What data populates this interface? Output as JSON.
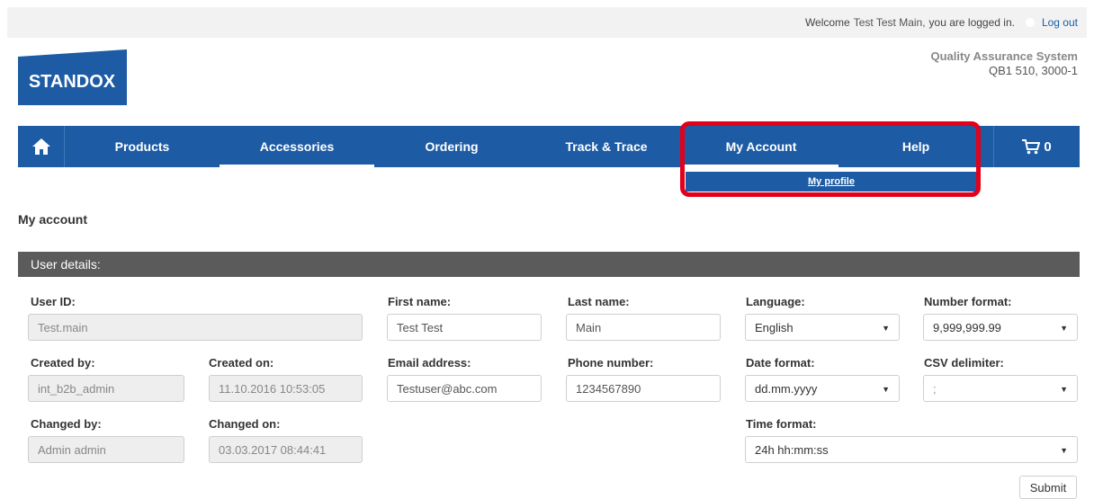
{
  "topbar": {
    "welcome": "Welcome",
    "username": "Test Test Main,",
    "logged_in": "you are logged in.",
    "logout": "Log out"
  },
  "logo": {
    "text": "STANDOX"
  },
  "system": {
    "title": "Quality Assurance System",
    "code": "QB1 510, 3000-1"
  },
  "nav": {
    "items": [
      "Products",
      "Accessories",
      "Ordering",
      "Track & Trace",
      "My Account",
      "Help"
    ],
    "active": [
      "Accessories",
      "My Account"
    ],
    "cart_count": "0"
  },
  "submenu": {
    "my_profile": "My profile"
  },
  "page": {
    "title": "My account"
  },
  "section": {
    "title": "User details:"
  },
  "form": {
    "user_id": {
      "label": "User ID:",
      "value": "Test.main"
    },
    "created_by": {
      "label": "Created by:",
      "value": "int_b2b_admin"
    },
    "created_on": {
      "label": "Created on:",
      "value": "11.10.2016 10:53:05"
    },
    "changed_by": {
      "label": "Changed by:",
      "value": "Admin admin"
    },
    "changed_on": {
      "label": "Changed on:",
      "value": "03.03.2017 08:44:41"
    },
    "first_name": {
      "label": "First name:",
      "value": "Test Test"
    },
    "last_name": {
      "label": "Last name:",
      "value": "Main"
    },
    "email": {
      "label": "Email address:",
      "value": "Testuser@abc.com"
    },
    "phone": {
      "label": "Phone number:",
      "value": "1234567890"
    },
    "language": {
      "label": "Language:",
      "value": "English"
    },
    "number_format": {
      "label": "Number format:",
      "value": "9,999,999.99"
    },
    "date_format": {
      "label": "Date format:",
      "value": "dd.mm.yyyy"
    },
    "csv_delimiter": {
      "label": "CSV delimiter:",
      "value": ";"
    },
    "time_format": {
      "label": "Time format:",
      "value": "24h hh:mm:ss"
    },
    "submit": "Submit"
  },
  "colors": {
    "nav_blue": "#1d5ba4",
    "highlight_red": "#e2001a",
    "section_gray": "#5b5b5b"
  },
  "icons": {
    "home": "home-icon",
    "cart": "cart-icon",
    "user": "user-icon"
  }
}
